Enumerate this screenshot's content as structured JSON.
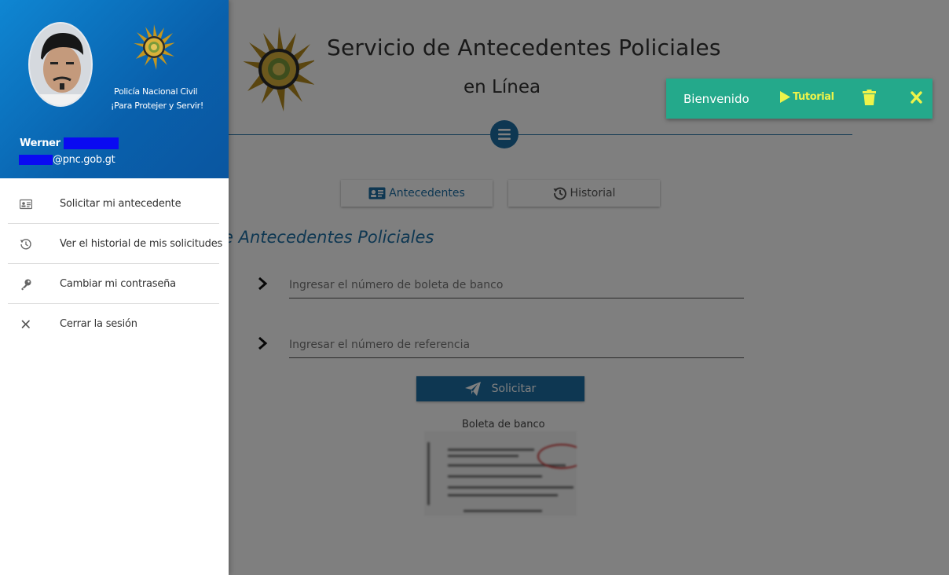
{
  "header": {
    "title": "Servicio de Antecedentes Policiales",
    "subtitle": "en Línea"
  },
  "tabs": [
    {
      "label": "Antecedentes"
    },
    {
      "label": "Historial"
    }
  ],
  "section": {
    "title": "e Antecedentes Policiales"
  },
  "form": {
    "boleta_placeholder": "Ingresar el número de boleta de banco",
    "referencia_placeholder": "Ingresar el número de referencia",
    "submit_label": "Solicitar",
    "boleta_image_label": "Boleta de banco"
  },
  "toast": {
    "message": "Bienvenido",
    "tutorial_label": "Tutorial"
  },
  "drawer": {
    "org_name": "Policía Nacional Civil",
    "org_motto": "¡Para Protejer y Servir!",
    "user_first_name": "Werner",
    "user_email_domain": "@pnc.gob.gt",
    "items": [
      {
        "label": "Solicitar mi antecedente",
        "icon": "id-card-icon"
      },
      {
        "label": "Ver el historial de mis solicitudes",
        "icon": "history-icon"
      },
      {
        "label": "Cambiar mi contraseña",
        "icon": "key-icon"
      },
      {
        "label": "Cerrar la sesión",
        "icon": "close-icon"
      }
    ]
  },
  "colors": {
    "primary": "#1c6ea4",
    "toast": "#24a98b",
    "toast_accent": "#eef34a",
    "drawer_header": "#0a66b2",
    "redaction": "#0a0af2"
  }
}
